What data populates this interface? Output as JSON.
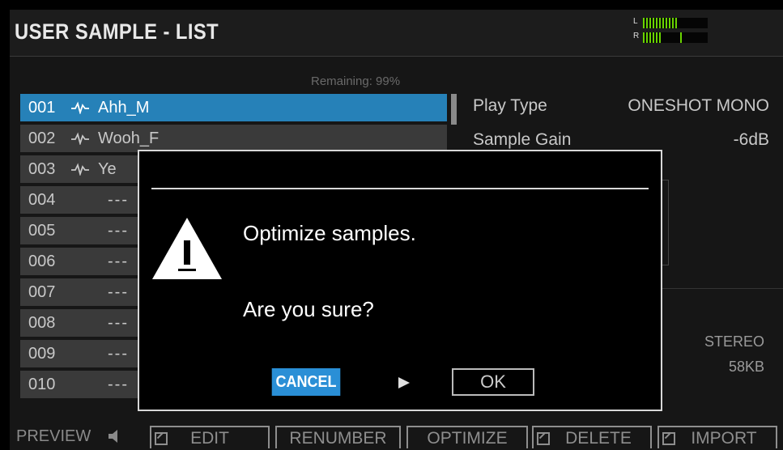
{
  "header": {
    "title": "USER SAMPLE - LIST",
    "meter": {
      "left_label": "L",
      "right_label": "R",
      "left_level": 0.55,
      "right_level": 0.3,
      "right_peak": 0.58
    }
  },
  "list": {
    "remaining": "Remaining: 99%",
    "rows": [
      {
        "num": "001",
        "name": "Ahh_M",
        "has_wave": true,
        "selected": true
      },
      {
        "num": "002",
        "name": "Wooh_F",
        "has_wave": true
      },
      {
        "num": "003",
        "name": "Ye",
        "has_wave": true
      },
      {
        "num": "004",
        "name": "---"
      },
      {
        "num": "005",
        "name": "---"
      },
      {
        "num": "006",
        "name": "---"
      },
      {
        "num": "007",
        "name": "---"
      },
      {
        "num": "008",
        "name": "---"
      },
      {
        "num": "009",
        "name": "---"
      },
      {
        "num": "010",
        "name": "---"
      }
    ]
  },
  "params": {
    "play_type_label": "Play Type",
    "play_type_value": "ONESHOT MONO",
    "sample_gain_label": "Sample Gain",
    "sample_gain_value": "-6dB"
  },
  "info": {
    "channels": "STEREO",
    "size": "58KB"
  },
  "footer": {
    "preview_label": "PREVIEW",
    "edit_label": "EDIT",
    "renumber_label": "RENUMBER",
    "optimize_label": "OPTIMIZE",
    "delete_label": "DELETE",
    "import_label": "IMPORT"
  },
  "dialog": {
    "message": "Optimize samples.",
    "question": "Are you sure?",
    "cancel_label": "CANCEL",
    "ok_label": "OK"
  },
  "colors": {
    "selection": "#2681b8",
    "cancel": "#2a8fd6",
    "meter": "#6ad400"
  },
  "icons": [
    "waveform-icon",
    "speaker-icon",
    "external-icon",
    "warning-icon",
    "arrow-right-icon"
  ]
}
